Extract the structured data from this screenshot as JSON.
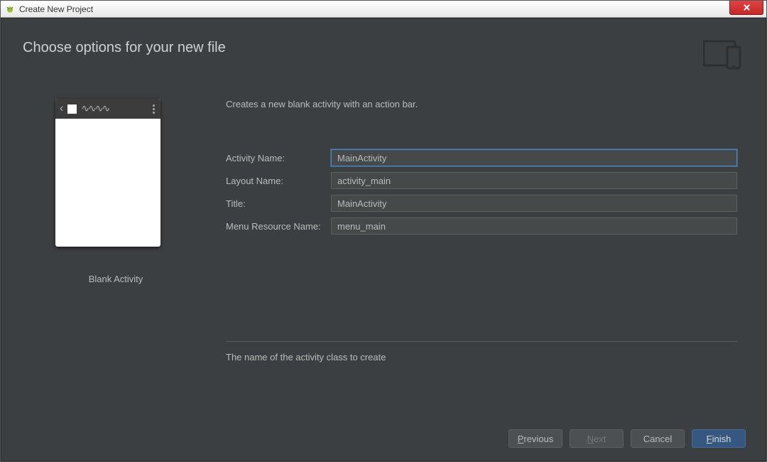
{
  "window": {
    "title": "Create New Project"
  },
  "page": {
    "heading": "Choose options for your new file",
    "description": "Creates a new blank activity with an action bar.",
    "preview_label": "Blank Activity",
    "hint": "The name of the activity class to create"
  },
  "form": {
    "activity_name": {
      "label": "Activity Name:",
      "value": "MainActivity"
    },
    "layout_name": {
      "label": "Layout Name:",
      "value": "activity_main"
    },
    "title": {
      "label": "Title:",
      "value": "MainActivity"
    },
    "menu_name": {
      "label": "Menu Resource Name:",
      "value": "menu_main"
    }
  },
  "buttons": {
    "previous_pre": "P",
    "previous_rest": "revious",
    "next_pre": "N",
    "next_rest": "ext",
    "cancel": "Cancel",
    "finish_pre": "F",
    "finish_rest": "inish"
  }
}
